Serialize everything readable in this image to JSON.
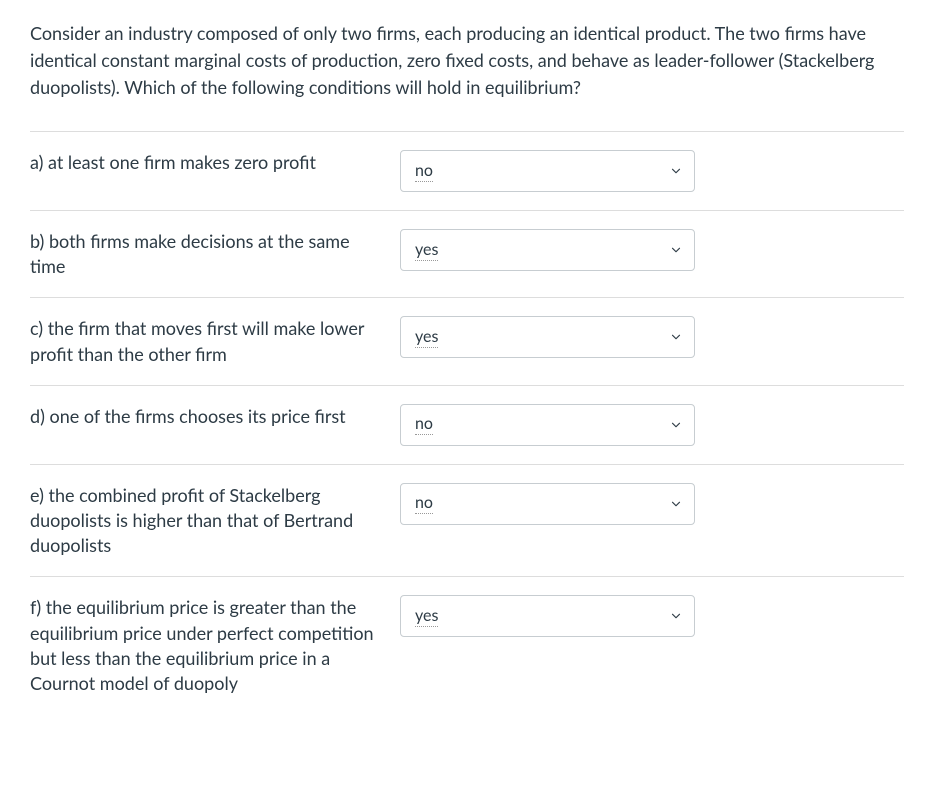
{
  "question": {
    "stem": "Consider an industry composed of only two firms, each producing an identical product. The two firms have identical constant marginal costs of production, zero fixed costs, and behave as leader-follower (Stackelberg duopolists). Which of the following conditions will hold in equilibrium?"
  },
  "answers": [
    {
      "label": "a) at least one firm makes zero profit",
      "selected": "no"
    },
    {
      "label": "b) both firms make decisions at the same time",
      "selected": "yes"
    },
    {
      "label": "c) the firm that moves first will make lower profit than the other firm",
      "selected": "yes"
    },
    {
      "label": "d) one of the firms chooses its price first",
      "selected": "no"
    },
    {
      "label": "e) the combined profit of Stackelberg duopolists is higher than that of Bertrand duopolists",
      "selected": "no"
    },
    {
      "label": "f) the equilibrium price is greater than the equilibrium price under perfect competition but less than the equilibrium price in a Cournot model of duopoly",
      "selected": "yes"
    }
  ]
}
